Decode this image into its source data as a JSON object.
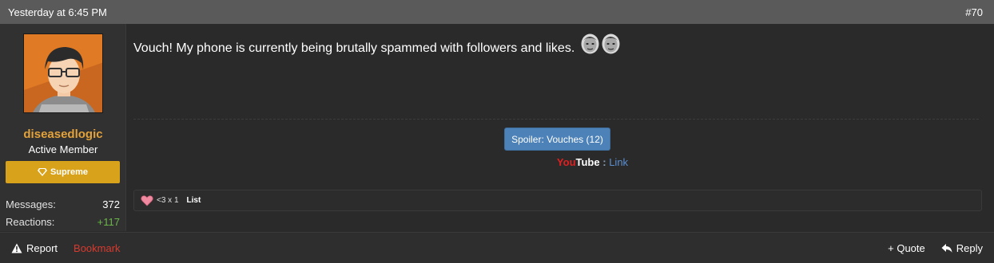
{
  "header": {
    "timestamp": "Yesterday at 6:45 PM",
    "post_number": "#70"
  },
  "user": {
    "name": "diseasedlogic",
    "title": "Active Member",
    "banner": "Supreme",
    "stats": [
      {
        "label": "Messages:",
        "value": "372"
      },
      {
        "label": "Reactions:",
        "value": "+117"
      }
    ]
  },
  "post": {
    "message": "Vouch! My phone is currently being brutally spammed with followers and likes.",
    "spoiler_label": "Spoiler: Vouches (12)",
    "youtube_you": "You",
    "youtube_tube": "Tube",
    "youtube_sep": ":",
    "youtube_link": "Link"
  },
  "reactions": {
    "summary": "<3 x 1",
    "list_label": "List"
  },
  "footer": {
    "report": "Report",
    "bookmark": "Bookmark",
    "quote": "+ Quote",
    "reply": "Reply"
  },
  "colors": {
    "username": "#e3a23a",
    "banner": "#d9a21b",
    "spoiler": "#4d82b8",
    "bookmark": "#d83a2e",
    "positive": "#6bb64a"
  }
}
